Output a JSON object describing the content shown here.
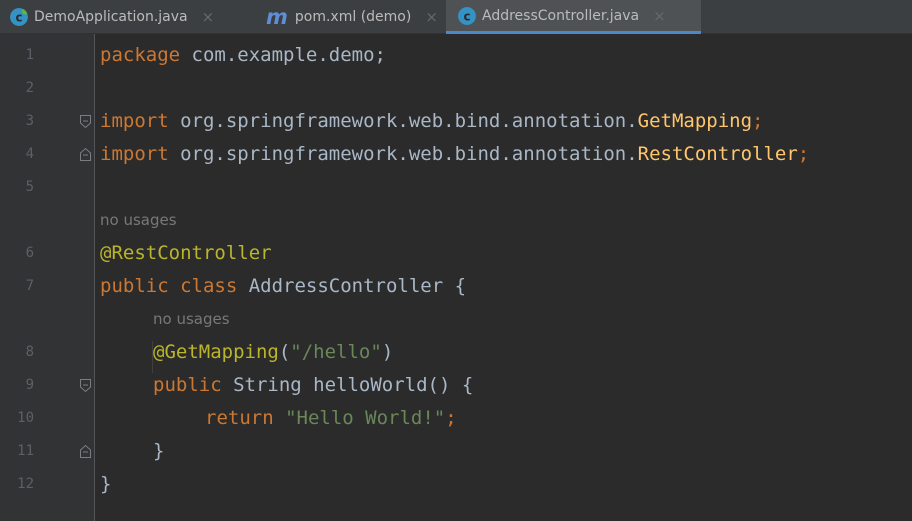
{
  "tabs": [
    {
      "label": "DemoApplication.java",
      "icon": "java-class-icon",
      "active": false
    },
    {
      "label": "pom.xml (demo)",
      "icon": "maven-icon",
      "icon_text": "m",
      "active": false
    },
    {
      "label": "AddressController.java",
      "icon": "java-class-icon",
      "active": true
    }
  ],
  "tab_close": "×",
  "hints": {
    "no_usages": "no usages"
  },
  "line_numbers": [
    "1",
    "2",
    "3",
    "4",
    "5",
    "6",
    "7",
    "8",
    "9",
    "10",
    "11",
    "12"
  ],
  "code": {
    "l1": {
      "kw": "package",
      "rest": " com.example.demo;"
    },
    "l3": {
      "kw": "import",
      "path": " org.springframework.web.bind.annotation.",
      "cls": "GetMapping",
      "end": ";"
    },
    "l4": {
      "kw": "import",
      "path": " org.springframework.web.bind.annotation.",
      "cls": "RestController",
      "end": ";"
    },
    "l6": {
      "ann": "@RestController"
    },
    "l7": {
      "kw": "public class",
      "name": " AddressController {"
    },
    "l8": {
      "ann": "@GetMapping",
      "open": "(",
      "str": "\"/hello\"",
      "close": ")"
    },
    "l9": {
      "kw": "public",
      "type": " String ",
      "method": "helloWorld",
      "rest": "() {"
    },
    "l10": {
      "kw": "return",
      "str": " \"Hello World!\"",
      "end": ";"
    },
    "l11": {
      "text": "}"
    },
    "l12": {
      "text": "}"
    }
  },
  "colors": {
    "background": "#2b2b2b",
    "gutter": "#313335",
    "keyword": "#cc7832",
    "annotation": "#bbb529",
    "string": "#6a8759",
    "text": "#a9b7c6",
    "class_ref": "#ffc66d",
    "active_tab_underline": "#4a88c7"
  }
}
